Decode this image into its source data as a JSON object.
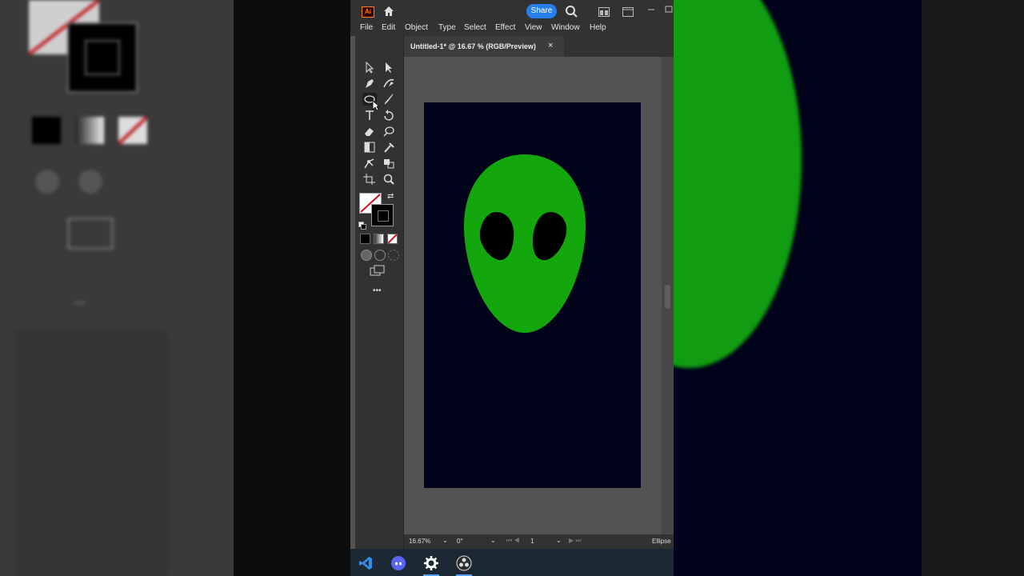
{
  "app": {
    "logo_text": "Ai",
    "share_label": "Share",
    "menu": [
      "File",
      "Edit",
      "Object",
      "Type",
      "Select",
      "Effect",
      "View",
      "Window",
      "Help"
    ],
    "document_tab": "Untitled-1* @ 16.67 % (RGB/Preview)",
    "tab_close": "×",
    "status": {
      "zoom": "16.67%",
      "rotation": "0°",
      "artboard_number": "1",
      "current_tool": "Ellipse"
    },
    "more_label": "•••"
  },
  "colors": {
    "artboard": "#01031a",
    "alien_face": "#13a60d",
    "alien_eyes": "#000000",
    "accent": "#2680eb"
  },
  "taskbar": {
    "icons": [
      "vscode-icon",
      "discord-icon",
      "settings-icon",
      "obs-icon"
    ]
  }
}
